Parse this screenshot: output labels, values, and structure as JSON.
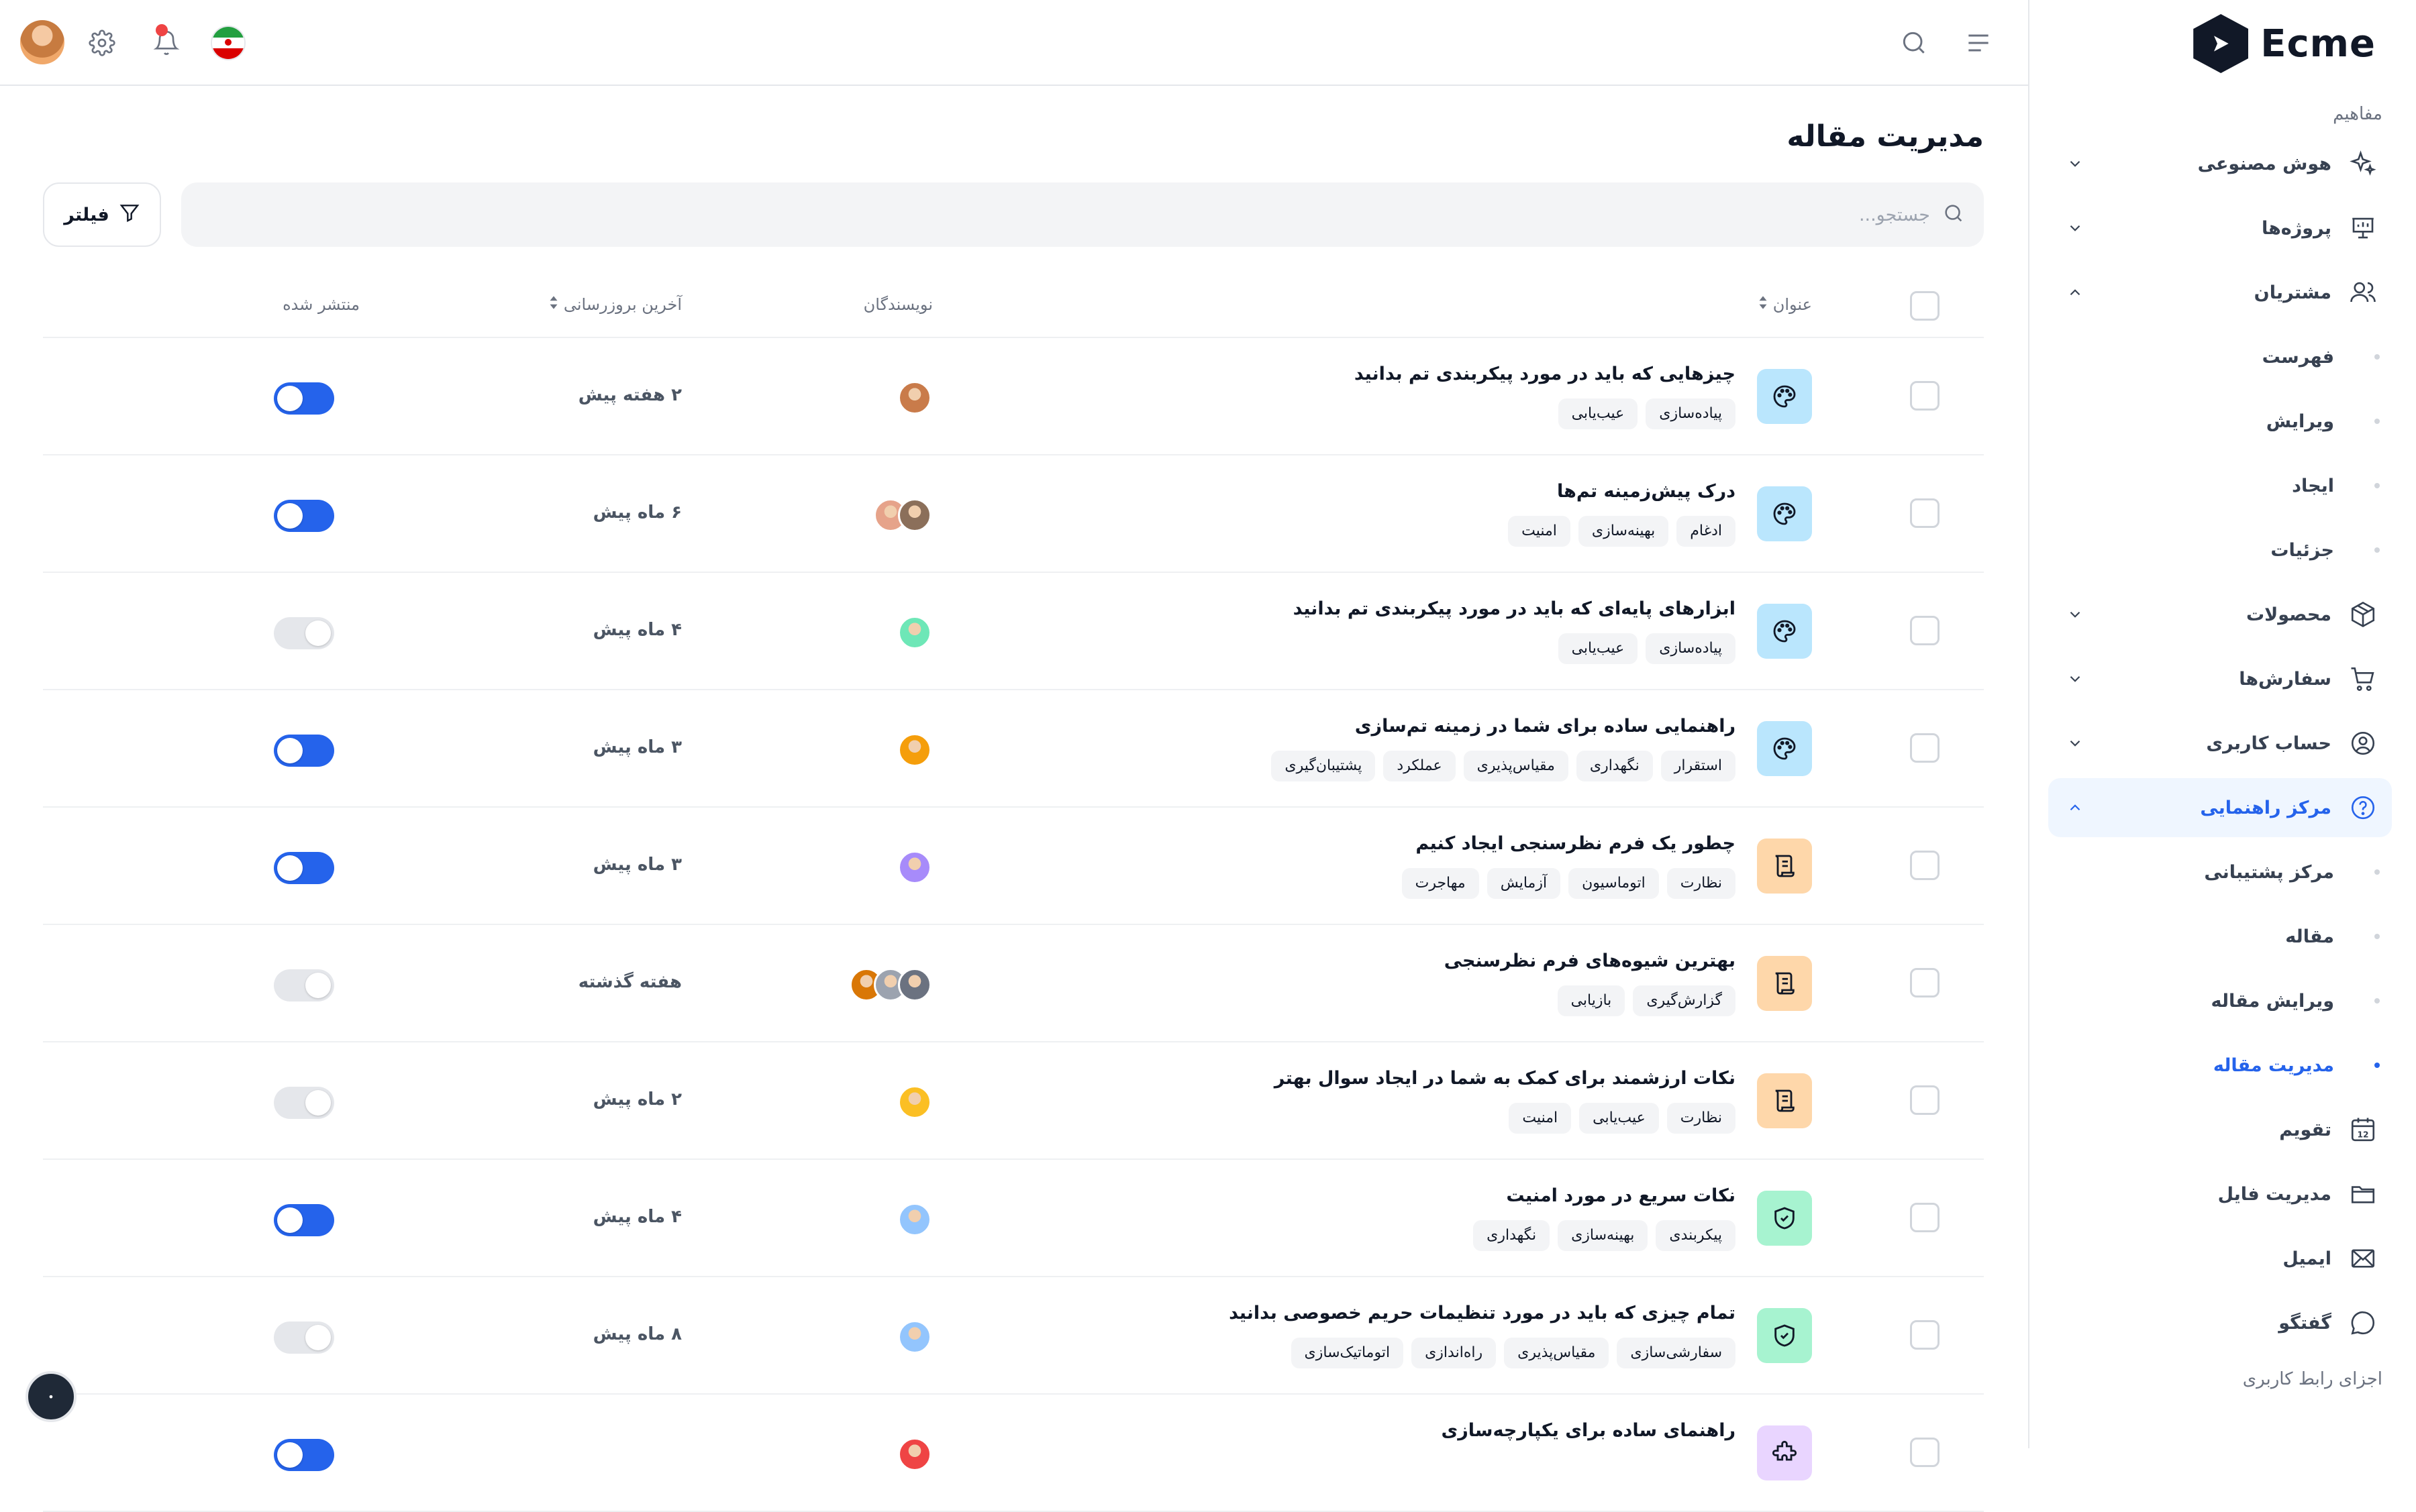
{
  "brand": {
    "name": "Ecme",
    "logo_icon": "ecme-logo"
  },
  "header": {
    "menu_icon": "menu-icon",
    "search_icon": "search-icon",
    "language_flag": "iran-flag",
    "notification_icon": "bell-icon",
    "settings_icon": "gear-icon",
    "avatar": "user-avatar"
  },
  "sidebar": {
    "section_concepts": "مفاهیم",
    "section_ui": "اجزای رابط کاربری",
    "items": [
      {
        "label": "هوش مصنوعی",
        "icon": "sparkles-icon",
        "expandable": true,
        "expanded": false
      },
      {
        "label": "پروژه‌ها",
        "icon": "presentation-icon",
        "expandable": true,
        "expanded": false
      },
      {
        "label": "مشتریان",
        "icon": "users-icon",
        "expandable": true,
        "expanded": true,
        "children": [
          "فهرست",
          "ویرایش",
          "ایجاد",
          "جزئیات"
        ]
      },
      {
        "label": "محصولات",
        "icon": "box-icon",
        "expandable": true,
        "expanded": false
      },
      {
        "label": "سفارش‌ها",
        "icon": "cart-icon",
        "expandable": true,
        "expanded": false
      },
      {
        "label": "حساب کاربری",
        "icon": "user-circle-icon",
        "expandable": true,
        "expanded": false
      },
      {
        "label": "مرکز راهنمایی",
        "icon": "help-circle-icon",
        "expandable": true,
        "expanded": true,
        "active": true,
        "children": [
          "مرکز پشتیبانی",
          "مقاله",
          "ویرایش مقاله",
          "مدیریت مقاله"
        ],
        "active_child": "مدیریت مقاله"
      },
      {
        "label": "تقویم",
        "icon": "calendar-icon",
        "badge": "12"
      },
      {
        "label": "مدیریت فایل",
        "icon": "folder-icon"
      },
      {
        "label": "ایمیل",
        "icon": "mail-icon"
      },
      {
        "label": "گفتگو",
        "icon": "chat-icon"
      }
    ]
  },
  "main": {
    "title": "مدیریت مقاله",
    "search_placeholder": "جستجو...",
    "filter_label": "فیلتر",
    "columns": {
      "title": "عنوان",
      "authors": "نویسندگان",
      "updated": "آخرین بروزرسانی",
      "published": "منتشر شده"
    },
    "rows": [
      {
        "title": "چیزهایی که باید در مورد پیکربندی تم بدانید",
        "category_icon": "palette-icon",
        "category_color": "#bae6fd",
        "tags": [
          "پیاده‌سازی",
          "عیب‌یابی"
        ],
        "authors": [
          "#c97b4a"
        ],
        "updated": "۲ هفته پیش",
        "published": true
      },
      {
        "title": "درک پیش‌زمینه تم‌ها",
        "category_icon": "palette-icon",
        "category_color": "#bae6fd",
        "tags": [
          "ادغام",
          "بهینه‌سازی",
          "امنیت"
        ],
        "authors": [
          "#e6a38a",
          "#8b6f5a"
        ],
        "updated": "۶ ماه پیش",
        "published": true
      },
      {
        "title": "ابزارهای پایه‌ای که باید در مورد پیکربندی تم بدانید",
        "category_icon": "palette-icon",
        "category_color": "#bae6fd",
        "tags": [
          "پیاده‌سازی",
          "عیب‌یابی"
        ],
        "authors": [
          "#6ee7b7"
        ],
        "updated": "۴ ماه پیش",
        "published": false
      },
      {
        "title": "راهنمایی ساده برای شما در زمینه تم‌سازی",
        "category_icon": "palette-icon",
        "category_color": "#bae6fd",
        "tags": [
          "استقرار",
          "نگهداری",
          "مقیاس‌پذیری",
          "عملکرد",
          "پشتیبان‌گیری"
        ],
        "authors": [
          "#f59e0b"
        ],
        "updated": "۳ ماه پیش",
        "published": true
      },
      {
        "title": "چطور یک فرم نظرسنجی ایجاد کنیم",
        "category_icon": "scroll-icon",
        "category_color": "#fed7aa",
        "tags": [
          "نظارت",
          "اتوماسیون",
          "آزمایش",
          "مهاجرت"
        ],
        "authors": [
          "#a78bfa"
        ],
        "updated": "۳ ماه پیش",
        "published": true
      },
      {
        "title": "بهترین شیوه‌های فرم نظرسنجی",
        "category_icon": "scroll-icon",
        "category_color": "#fed7aa",
        "tags": [
          "گزارش‌گیری",
          "بازیابی"
        ],
        "authors": [
          "#d97706",
          "#9ca3af",
          "#6b7280"
        ],
        "updated": "هفته گذشته",
        "published": false
      },
      {
        "title": "نکات ارزشمند برای کمک به شما در ایجاد سوال بهتر",
        "category_icon": "scroll-icon",
        "category_color": "#fed7aa",
        "tags": [
          "نظارت",
          "عیب‌یابی",
          "امنیت"
        ],
        "authors": [
          "#fbbf24"
        ],
        "updated": "۲ ماه پیش",
        "published": false
      },
      {
        "title": "نکات سریع در مورد امنیت",
        "category_icon": "shield-icon",
        "category_color": "#a7f3d0",
        "tags": [
          "پیکربندی",
          "بهینه‌سازی",
          "نگهداری"
        ],
        "authors": [
          "#93c5fd"
        ],
        "updated": "۴ ماه پیش",
        "published": true
      },
      {
        "title": "تمام چیزی که باید در مورد تنظیمات حریم خصوصی بدانید",
        "category_icon": "shield-icon",
        "category_color": "#a7f3d0",
        "tags": [
          "سفارشی‌سازی",
          "مقیاس‌پذیری",
          "راه‌اندازی",
          "اتوماتیک‌سازی"
        ],
        "authors": [
          "#93c5fd"
        ],
        "updated": "۸ ماه پیش",
        "published": false
      },
      {
        "title": "راهنمای ساده برای یکپارچه‌سازی",
        "category_icon": "puzzle-icon",
        "category_color": "#e9d5ff",
        "tags": [],
        "authors": [
          "#ef4444"
        ],
        "updated": "",
        "published": true
      }
    ]
  },
  "colors": {
    "accent": "#2563eb",
    "active_bg": "#eff6ff",
    "toggle_off": "#e5e7eb"
  }
}
